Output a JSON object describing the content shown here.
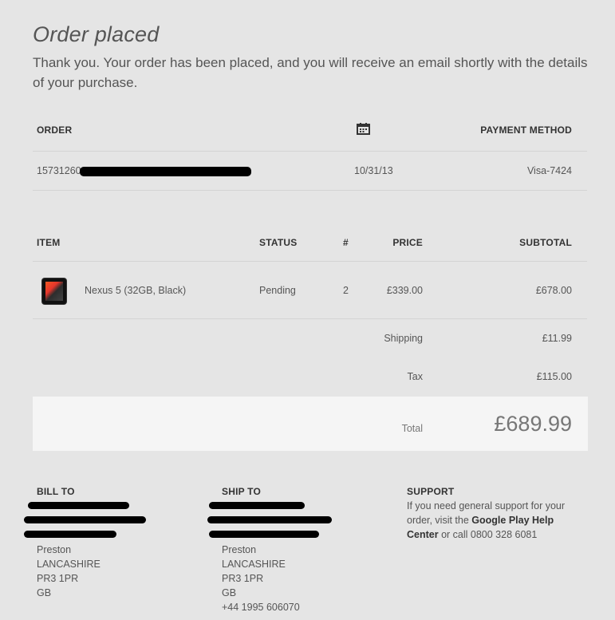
{
  "title": "Order placed",
  "intro": "Thank you. Your order has been placed, and you will receive an email shortly with the details of your purchase.",
  "order_table": {
    "header_order": "ORDER",
    "header_date_icon": "calendar-icon",
    "header_payment": "PAYMENT METHOD",
    "order_number": "15731260",
    "date": "10/31/13",
    "payment": "Visa-7424"
  },
  "items_table": {
    "header_item": "ITEM",
    "header_status": "STATUS",
    "header_qty": "#",
    "header_price": "PRICE",
    "header_subtotal": "SUBTOTAL",
    "item_name": "Nexus 5 (32GB, Black)",
    "item_status": "Pending",
    "item_qty": "2",
    "item_price": "£339.00",
    "item_subtotal": "£678.00",
    "shipping_label": "Shipping",
    "shipping_value": "£11.99",
    "tax_label": "Tax",
    "tax_value": "£115.00",
    "total_label": "Total",
    "total_value": "£689.99"
  },
  "bill_to": {
    "heading": "BILL TO",
    "city": "Preston",
    "county": "LANCASHIRE",
    "postcode": "PR3 1PR",
    "country": "GB"
  },
  "ship_to": {
    "heading": "SHIP TO",
    "city": "Preston",
    "county": "LANCASHIRE",
    "postcode": "PR3 1PR",
    "country": "GB",
    "phone": "+44 1995 606070"
  },
  "support": {
    "heading": "SUPPORT",
    "text_before": "If you need general support for your order, visit the ",
    "link": "Google Play Help Center",
    "text_after": " or call 0800 328 6081"
  }
}
